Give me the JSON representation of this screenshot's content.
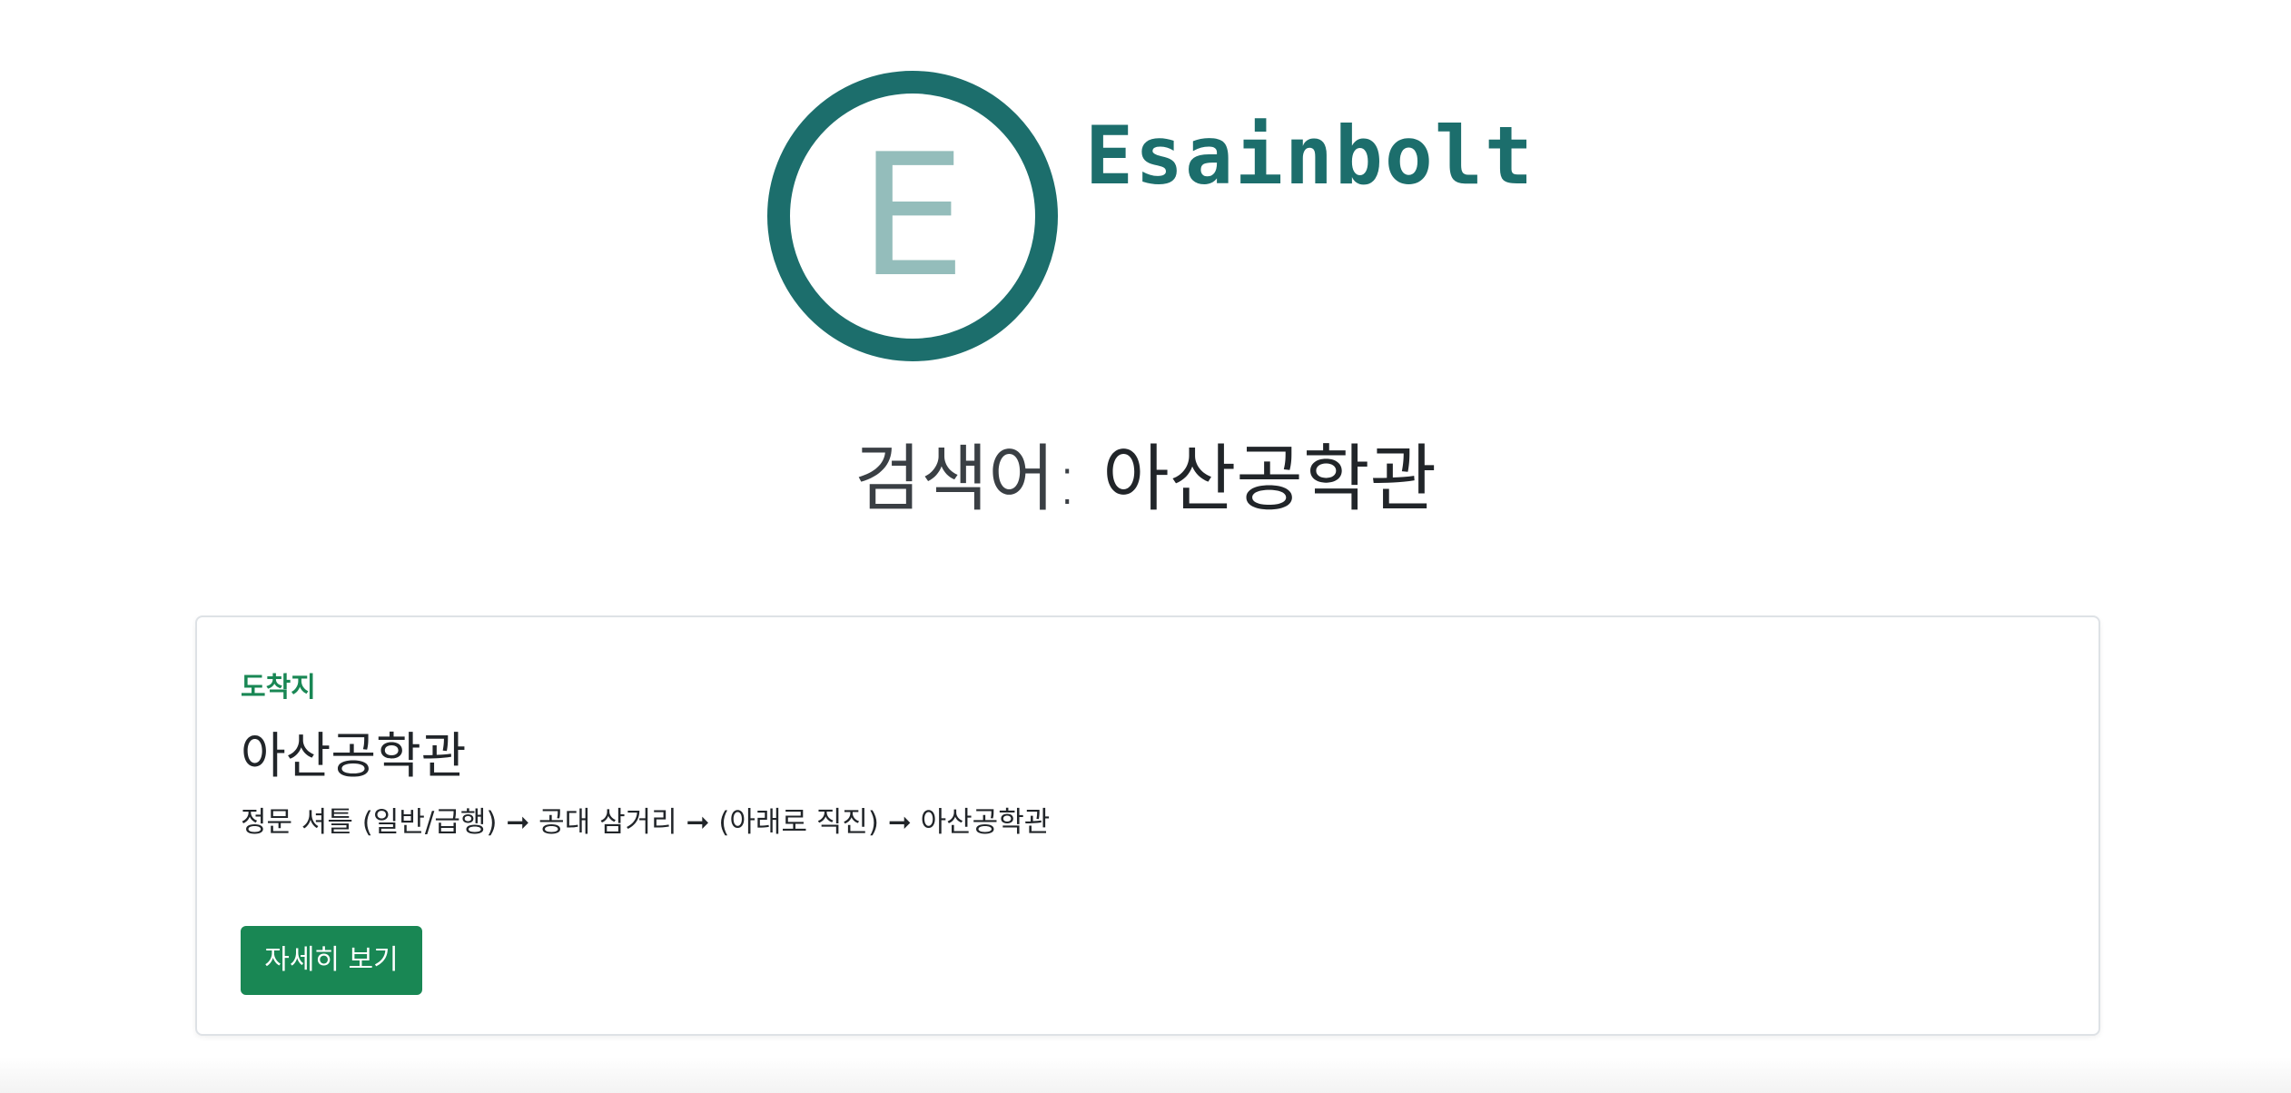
{
  "logo": {
    "letter": "E",
    "brand_name": "Esainbolt",
    "colors": {
      "ring": "#1c6e6c",
      "letter": "#94bdbb"
    }
  },
  "search": {
    "label": "검색어:",
    "term": "아산공학관"
  },
  "result_card": {
    "eyebrow": "도착지",
    "title": "아산공학관",
    "route": "정문 셔틀 (일반/급행) ➞ 공대 삼거리 ➞ (아래로 직진) ➞ 아산공학관",
    "button_label": "자세히 보기",
    "accent_color": "#198754"
  }
}
